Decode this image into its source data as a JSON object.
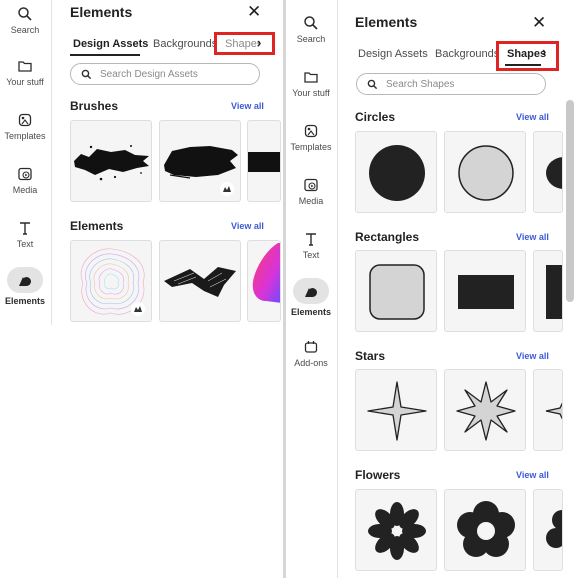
{
  "rail_left": {
    "items": [
      {
        "label": "Search"
      },
      {
        "label": "Your stuff"
      },
      {
        "label": "Templates"
      },
      {
        "label": "Media"
      },
      {
        "label": "Text"
      },
      {
        "label": "Elements"
      }
    ]
  },
  "panel_left": {
    "title": "Elements",
    "tabs": [
      "Design Assets",
      "Backgrounds",
      "Shapes"
    ],
    "search_placeholder": "Search Design Assets",
    "sections": [
      {
        "title": "Brushes",
        "view_all": "View all"
      },
      {
        "title": "Elements",
        "view_all": "View all"
      }
    ]
  },
  "rail_right": {
    "items": [
      {
        "label": "Search"
      },
      {
        "label": "Your stuff"
      },
      {
        "label": "Templates"
      },
      {
        "label": "Media"
      },
      {
        "label": "Text"
      },
      {
        "label": "Elements"
      },
      {
        "label": "Add-ons"
      }
    ]
  },
  "panel_right": {
    "title": "Elements",
    "tabs": [
      "Design Assets",
      "Backgrounds",
      "Shapes"
    ],
    "search_placeholder": "Search Shapes",
    "sections": [
      {
        "title": "Circles",
        "view_all": "View all"
      },
      {
        "title": "Rectangles",
        "view_all": "View all"
      },
      {
        "title": "Stars",
        "view_all": "View all"
      },
      {
        "title": "Flowers",
        "view_all": "View all"
      }
    ]
  },
  "colors": {
    "accent_link": "#3d5ad6",
    "highlight_box": "#e02424",
    "shape_fill": "#222222",
    "tile_bg": "#f5f5f5"
  }
}
